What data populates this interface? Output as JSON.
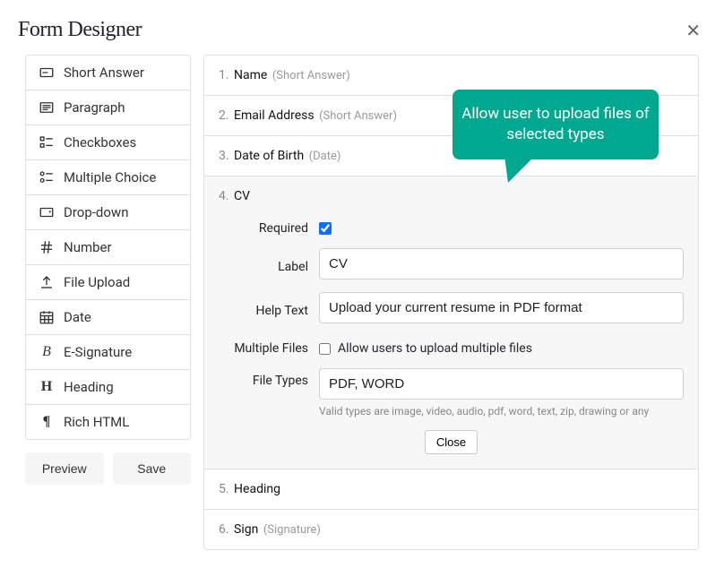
{
  "header": {
    "title": "Form Designer"
  },
  "sidebar": {
    "field_types": [
      {
        "label": "Short Answer",
        "icon": "short-answer-icon"
      },
      {
        "label": "Paragraph",
        "icon": "paragraph-icon"
      },
      {
        "label": "Checkboxes",
        "icon": "checkboxes-icon"
      },
      {
        "label": "Multiple Choice",
        "icon": "multiple-choice-icon"
      },
      {
        "label": "Drop-down",
        "icon": "drop-down-icon"
      },
      {
        "label": "Number",
        "icon": "number-icon"
      },
      {
        "label": "File Upload",
        "icon": "file-upload-icon"
      },
      {
        "label": "Date",
        "icon": "date-icon"
      },
      {
        "label": "E-Signature",
        "icon": "signature-icon"
      },
      {
        "label": "Heading",
        "icon": "heading-icon"
      },
      {
        "label": "Rich HTML",
        "icon": "rich-html-icon"
      }
    ],
    "preview_label": "Preview",
    "save_label": "Save"
  },
  "fields": [
    {
      "num": "1.",
      "name": "Name",
      "hint": "(Short Answer)"
    },
    {
      "num": "2.",
      "name": "Email Address",
      "hint": "(Short Answer)"
    },
    {
      "num": "3.",
      "name": "Date of Birth",
      "hint": "(Date)"
    },
    {
      "num": "4.",
      "name": "CV",
      "hint": ""
    },
    {
      "num": "5.",
      "name": "Heading",
      "hint": ""
    },
    {
      "num": "6.",
      "name": "Sign",
      "hint": "(Signature)"
    }
  ],
  "editor": {
    "required_label": "Required",
    "required_checked": true,
    "label_label": "Label",
    "label_value": "CV",
    "help_label": "Help Text",
    "help_value": "Upload your current resume in PDF format",
    "multiple_label": "Multiple Files",
    "multiple_text": "Allow users to upload multiple files",
    "multiple_checked": false,
    "types_label": "File Types",
    "types_value": "PDF, WORD",
    "types_help": "Valid types are image, video, audio, pdf, word, text, zip, drawing or any",
    "close_label": "Close"
  },
  "callout": {
    "text": "Allow user to upload files of selected types"
  }
}
